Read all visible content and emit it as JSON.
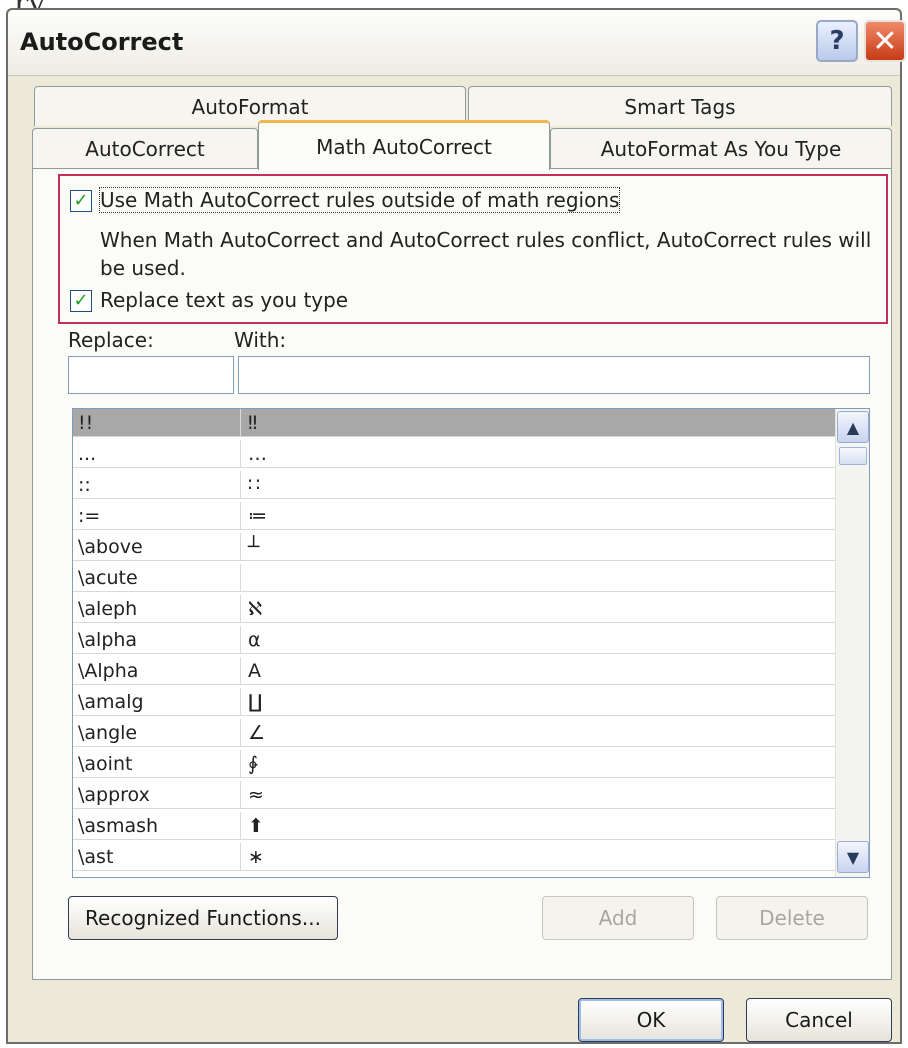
{
  "window": {
    "title": "AutoCorrect"
  },
  "titlebar": {
    "help_glyph": "?",
    "close_glyph": "✕"
  },
  "top_fragment": "ry,",
  "tabs": {
    "row_back": [
      {
        "label": "AutoFormat"
      },
      {
        "label": "Smart Tags"
      }
    ],
    "row_front": [
      {
        "label": "AutoCorrect"
      },
      {
        "label": "Math AutoCorrect",
        "active": true
      },
      {
        "label": "AutoFormat As You Type"
      }
    ]
  },
  "options": {
    "use_outside": {
      "label": "Use Math AutoCorrect rules outside of math regions",
      "checked": true
    },
    "conflict_note": [
      "When Math AutoCorrect and AutoCorrect rules conflict, AutoCorrect rules will",
      "be used."
    ],
    "replace_as_type": {
      "label": "Replace text as you type",
      "checked": true
    }
  },
  "fields": {
    "replace_label": "Replace:",
    "with_label": "With:",
    "replace_value": "",
    "with_value": ""
  },
  "list": {
    "rows": [
      {
        "replace": "!!",
        "with": "‼"
      },
      {
        "replace": "...",
        "with": "…"
      },
      {
        "replace": "::",
        "with": "∷"
      },
      {
        "replace": ":=",
        "with": "≔"
      },
      {
        "replace": "\\above",
        "with": "┴"
      },
      {
        "replace": "\\acute",
        "with": ""
      },
      {
        "replace": "\\aleph",
        "with": "ℵ"
      },
      {
        "replace": "\\alpha",
        "with": "α"
      },
      {
        "replace": "\\Alpha",
        "with": "A"
      },
      {
        "replace": "\\amalg",
        "with": "∐"
      },
      {
        "replace": "\\angle",
        "with": "∠"
      },
      {
        "replace": "\\aoint",
        "with": "∳"
      },
      {
        "replace": "\\approx",
        "with": "≈"
      },
      {
        "replace": "\\asmash",
        "with": "⬆"
      },
      {
        "replace": "\\ast",
        "with": "∗"
      }
    ],
    "scroll_up_glyph": "▲",
    "scroll_down_glyph": "▼"
  },
  "buttons": {
    "recognized_functions": "Recognized Functions...",
    "add": "Add",
    "delete": "Delete",
    "ok": "OK",
    "cancel": "Cancel"
  },
  "colors": {
    "highlight_border": "#c4305a",
    "check_mark": "#21a121",
    "dialog_bg": "#ece9d8"
  }
}
